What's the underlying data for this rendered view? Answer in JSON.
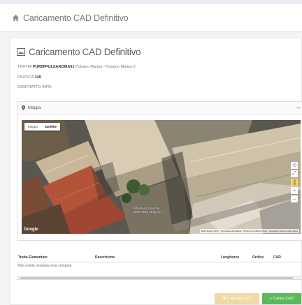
{
  "header": {
    "title": "Caricamento CAD Definitivo",
    "icon": "home-icon"
  },
  "card": {
    "title": "Caricamento CAD Definitivo",
    "tratta_label": "TRATTA",
    "tratta_code": "PUR5FPULSANOMA01",
    "tratta_desc": "Pulsano Marina - Pulsano Marina 2",
    "pratica_label": "PRATICA",
    "pratica_value": "118",
    "contratto_label": "CONTRATTO INFR."
  },
  "map_panel": {
    "title": "Mappa",
    "toggle": "–",
    "map_type_mappa": "Mappa",
    "map_type_satellite": "Satellite",
    "zoom_in": "+",
    "zoom_out": "–",
    "place_label": "Biblioteca Centrale\ndello Stato Maggiore",
    "google": "Google",
    "attribution": "Dati mappa ©2017 · Scorciatoie da tastiera · Termini e condizioni d'uso · Segnala un errore nella mappa"
  },
  "table": {
    "columns": [
      "Tratta Elementare",
      "Descrizione",
      "Lunghezza",
      "Ordine",
      "CAD"
    ],
    "empty_text": "Non esiste nessuna voce computo"
  },
  "actions": {
    "cancel_label": "✖ Cancella CAD",
    "upload_label": "+ Carica CAD"
  },
  "colors": {
    "upload": "#5cb85c",
    "cancel": "#efd9a6"
  }
}
